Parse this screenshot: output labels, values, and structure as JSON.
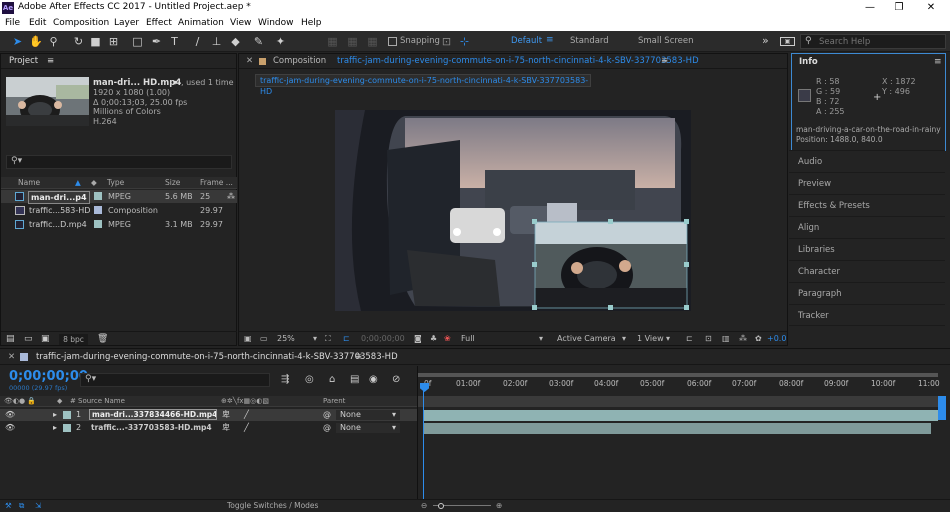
{
  "window": {
    "title": "Adobe After Effects CC 2017 - Untitled Project.aep *",
    "min": "—",
    "max": "❐",
    "close": "✕",
    "logo": "Ae"
  },
  "menu": [
    "File",
    "Edit",
    "Composition",
    "Layer",
    "Effect",
    "Animation",
    "View",
    "Window",
    "Help"
  ],
  "toolbar": {
    "snapping": "Snapping",
    "workspaces": [
      "Default",
      "Standard",
      "Small Screen"
    ],
    "more": "»",
    "search_placeholder": "Search Help"
  },
  "project": {
    "title": "Project",
    "menu": "≡",
    "thumb_name": "man-dri... HD.mp4",
    "used": ", used 1 time",
    "info": [
      "1920 x 1080 (1.00)",
      "Δ 0;00:13;03, 25.00 fps",
      "Millions of Colors",
      "H.264"
    ],
    "search_placeholder": "",
    "columns": [
      "Name",
      "Type",
      "Size",
      "Frame ..."
    ],
    "items": [
      {
        "name": "man-dri...p4",
        "type": "MPEG",
        "size": "5.6 MB",
        "fps": "25",
        "selected": true,
        "chip": "#9ec2c2",
        "kind": "file"
      },
      {
        "name": "traffic...583-HD",
        "type": "Composition",
        "size": "",
        "fps": "29.97",
        "selected": false,
        "chip": "#a9b9d9",
        "kind": "comp"
      },
      {
        "name": "traffic...D.mp4",
        "type": "MPEG",
        "size": "3.1 MB",
        "fps": "29.97",
        "selected": false,
        "chip": "#9ec2c2",
        "kind": "file"
      }
    ],
    "bpc": "8 bpc"
  },
  "composition": {
    "label": "Composition",
    "name": "traffic-jam-during-evening-commute-on-i-75-north-cincinnati-4-k-SBV-337703583-HD",
    "tab": "traffic-jam-during-evening-commute-on-i-75-north-cincinnati-4-k-SBV-337703583-HD",
    "menu": "≡",
    "footer": {
      "zoom": "25%",
      "time": "0;00;00;00",
      "quality": "Full",
      "camera": "Active Camera",
      "views": "1 View",
      "exposure": "+0.0"
    }
  },
  "info": {
    "title": "Info",
    "menu": "≡",
    "r": "R : 58",
    "g": "G : 59",
    "b": "B : 72",
    "a": "A : 255",
    "x": "X : 1872",
    "y": "Y : 496",
    "name": "man-driving-a-car-on-the-road-in-rainy",
    "position": "Position: 1488.0, 840.0",
    "swatch": "#3a3b48"
  },
  "panels": [
    "Audio",
    "Preview",
    "Effects & Presets",
    "Align",
    "Libraries",
    "Character",
    "Paragraph",
    "Tracker"
  ],
  "timeline": {
    "title": "traffic-jam-during-evening-commute-on-i-75-north-cincinnati-4-k-SBV-337703583-HD",
    "menu": "≡",
    "timecode": "0;00;00;00",
    "fps": "00000 (29.97 fps)",
    "search_placeholder": "",
    "col_source": "Source Name",
    "col_parent": "Parent",
    "ticks": [
      "0f",
      "01:00f",
      "02:00f",
      "03:00f",
      "04:00f",
      "05:00f",
      "06:00f",
      "07:00f",
      "08:00f",
      "09:00f",
      "10:00f",
      "11:00"
    ],
    "layers": [
      {
        "num": "1",
        "name": "man-dri...337834466-HD.mp4",
        "parent": "None",
        "selected": true
      },
      {
        "num": "2",
        "name": "traffic...-337703583-HD.mp4",
        "parent": "None",
        "selected": false
      }
    ],
    "footer": "Toggle Switches / Modes"
  }
}
